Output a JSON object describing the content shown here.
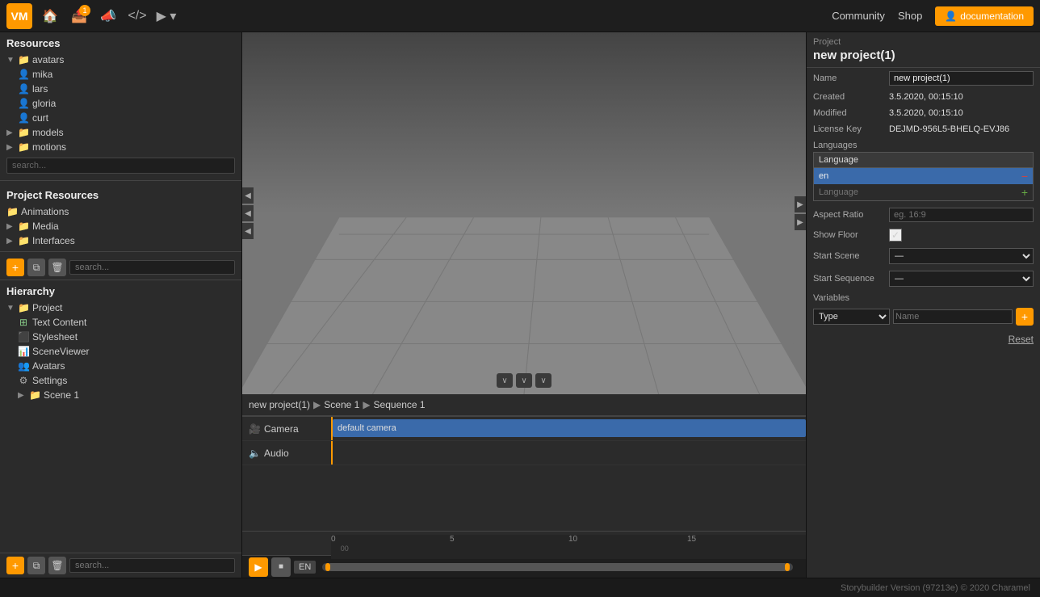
{
  "topbar": {
    "logo": "VM",
    "nav_icons": [
      "home",
      "upload",
      "megaphone",
      "code",
      "play"
    ],
    "upload_badge": "1",
    "community": "Community",
    "shop": "Shop",
    "doc_btn": "documentation"
  },
  "resources": {
    "title": "Resources",
    "tree": [
      {
        "id": "avatars",
        "label": "avatars",
        "type": "folder",
        "expanded": true,
        "indent": 0
      },
      {
        "id": "mika",
        "label": "mika",
        "type": "avatar",
        "indent": 1
      },
      {
        "id": "lars",
        "label": "lars",
        "type": "avatar",
        "indent": 1
      },
      {
        "id": "gloria",
        "label": "gloria",
        "type": "avatar",
        "indent": 1
      },
      {
        "id": "curt",
        "label": "curt",
        "type": "avatar",
        "indent": 1
      },
      {
        "id": "models",
        "label": "models",
        "type": "folder",
        "indent": 0
      },
      {
        "id": "motions",
        "label": "motions",
        "type": "folder",
        "indent": 0
      }
    ],
    "search_placeholder": "search..."
  },
  "project_resources": {
    "title": "Project Resources",
    "tree": [
      {
        "id": "animations",
        "label": "Animations",
        "type": "folder",
        "indent": 0
      },
      {
        "id": "media",
        "label": "Media",
        "type": "folder",
        "indent": 0
      },
      {
        "id": "interfaces",
        "label": "Interfaces",
        "type": "folder",
        "indent": 0
      }
    ]
  },
  "hierarchy": {
    "title": "Hierarchy",
    "toolbar": {
      "add": "+",
      "copy": "⧉",
      "delete": "🗑",
      "search_placeholder": "search..."
    },
    "tree": [
      {
        "id": "project",
        "label": "Project",
        "type": "folder",
        "expanded": true,
        "indent": 0
      },
      {
        "id": "text-content",
        "label": "Text Content",
        "type": "text",
        "indent": 1
      },
      {
        "id": "stylesheet",
        "label": "Stylesheet",
        "type": "stylesheet",
        "indent": 1
      },
      {
        "id": "sceneviewer",
        "label": "SceneViewer",
        "type": "scene",
        "indent": 1
      },
      {
        "id": "avatars",
        "label": "Avatars",
        "type": "avatars",
        "indent": 1
      },
      {
        "id": "settings",
        "label": "Settings",
        "type": "settings",
        "indent": 1
      },
      {
        "id": "scene1",
        "label": "Scene 1",
        "type": "folder",
        "indent": 1
      }
    ]
  },
  "breadcrumb": {
    "items": [
      "new project(1)",
      "Scene 1",
      "Sequence 1"
    ],
    "separators": [
      "▶",
      "▶"
    ]
  },
  "timeline": {
    "tracks": [
      {
        "id": "camera",
        "label": "Camera",
        "icon": "camera",
        "block": "default camera"
      },
      {
        "id": "audio",
        "label": "Audio",
        "icon": "audio",
        "block": ""
      }
    ],
    "ruler": {
      "marks": [
        {
          "pos": 0,
          "label": "0"
        },
        {
          "pos": 20,
          "label": "5"
        },
        {
          "pos": 40,
          "label": "10"
        },
        {
          "pos": 60,
          "label": "15"
        }
      ],
      "submarks": [
        "00"
      ]
    },
    "playhead_pos": 0,
    "controls": {
      "play": "▶",
      "stop": "■",
      "lang": "EN"
    }
  },
  "right_panel": {
    "project_label": "Project",
    "project_name": "new project(1)",
    "fields": {
      "name_label": "Name",
      "name_value": "new project(1)",
      "created_label": "Created",
      "created_value": "3.5.2020, 00:15:10",
      "modified_label": "Modified",
      "modified_value": "3.5.2020, 00:15:10",
      "license_label": "License Key",
      "license_value": "DEJMD-956L5-BHELQ-EVJ86"
    },
    "languages": {
      "section_label": "Languages",
      "header": "Language",
      "items": [
        "en"
      ],
      "add_placeholder": "Language",
      "add_btn": "+"
    },
    "aspect_ratio": {
      "label": "Aspect Ratio",
      "placeholder": "eg. 16:9"
    },
    "show_floor": {
      "label": "Show Floor",
      "checked": true
    },
    "start_scene": {
      "label": "Start Scene",
      "value": "—"
    },
    "start_sequence": {
      "label": "Start Sequence",
      "value": "—"
    },
    "variables": {
      "label": "Variables",
      "type_placeholder": "Type",
      "name_placeholder": "Name",
      "add_btn": "+"
    },
    "reset_btn": "Reset"
  },
  "status_bar": {
    "text": "Storybuilder Version (97213e)    © 2020 Charamel"
  }
}
